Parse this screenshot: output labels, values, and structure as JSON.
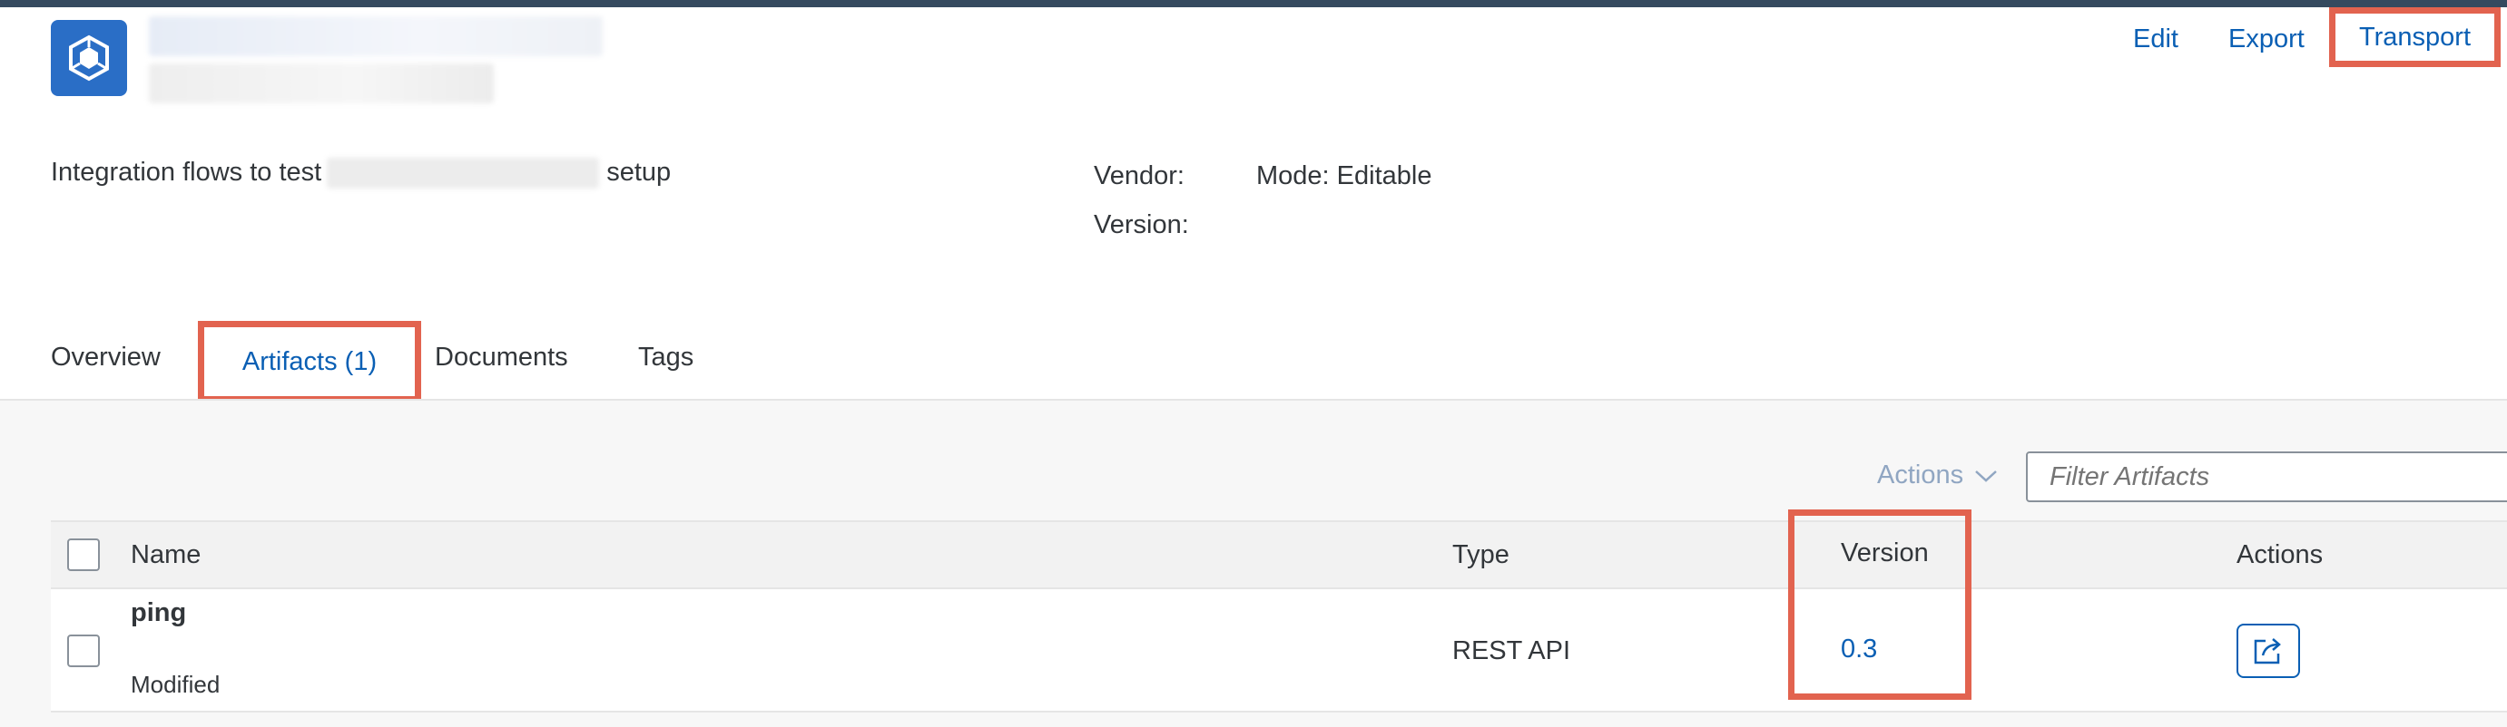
{
  "header": {
    "buttons": {
      "edit": "Edit",
      "export": "Export",
      "transport": "Transport"
    },
    "description_prefix": "Integration flows to test",
    "description_suffix": "setup",
    "vendor_label": "Vendor:",
    "version_label": "Version:",
    "mode": "Mode: Editable",
    "icon": "package-icon"
  },
  "tabs": [
    {
      "label": "Overview"
    },
    {
      "label": "Artifacts (1)",
      "selected": true
    },
    {
      "label": "Documents"
    },
    {
      "label": "Tags"
    }
  ],
  "toolbar": {
    "actions_label": "Actions",
    "filter_placeholder": "Filter Artifacts"
  },
  "table": {
    "columns": {
      "name": "Name",
      "type": "Type",
      "version": "Version",
      "actions": "Actions"
    },
    "rows": [
      {
        "name": "ping",
        "status": "Modified",
        "type": "REST API",
        "version": "0.3",
        "action_icon": "export-icon"
      }
    ]
  },
  "colors": {
    "accent": "#0a5fb4",
    "highlight": "#e2634f",
    "shell_bar": "#354a5f",
    "icon_bg": "#2a6ec6"
  }
}
